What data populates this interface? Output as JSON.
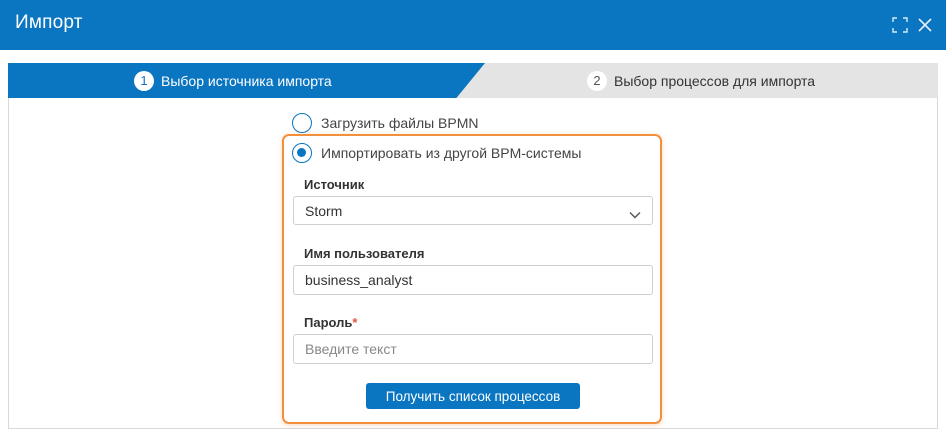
{
  "dialog": {
    "title": "Импорт",
    "icons": {
      "expand": "expand-icon",
      "close": "close-icon"
    }
  },
  "wizard": {
    "steps": [
      {
        "number": "1",
        "label": "Выбор источника импорта",
        "active": true
      },
      {
        "number": "2",
        "label": "Выбор процессов для импорта",
        "active": false
      }
    ]
  },
  "import_options": [
    {
      "label": "Загрузить файлы BPMN",
      "checked": false
    },
    {
      "label": "Импортировать из другой BPM-системы",
      "checked": true
    }
  ],
  "form": {
    "source": {
      "label": "Источник",
      "value": "Storm"
    },
    "username": {
      "label": "Имя пользователя",
      "value": "business_analyst"
    },
    "password": {
      "label": "Пароль",
      "required_mark": "*",
      "value": "",
      "placeholder": "Введите текст"
    },
    "submit_label": "Получить список процессов"
  },
  "colors": {
    "accent": "#0a75c1",
    "highlight": "#f28f3c",
    "required": "#e8523a",
    "inactive_step": "#e4e4e4"
  }
}
